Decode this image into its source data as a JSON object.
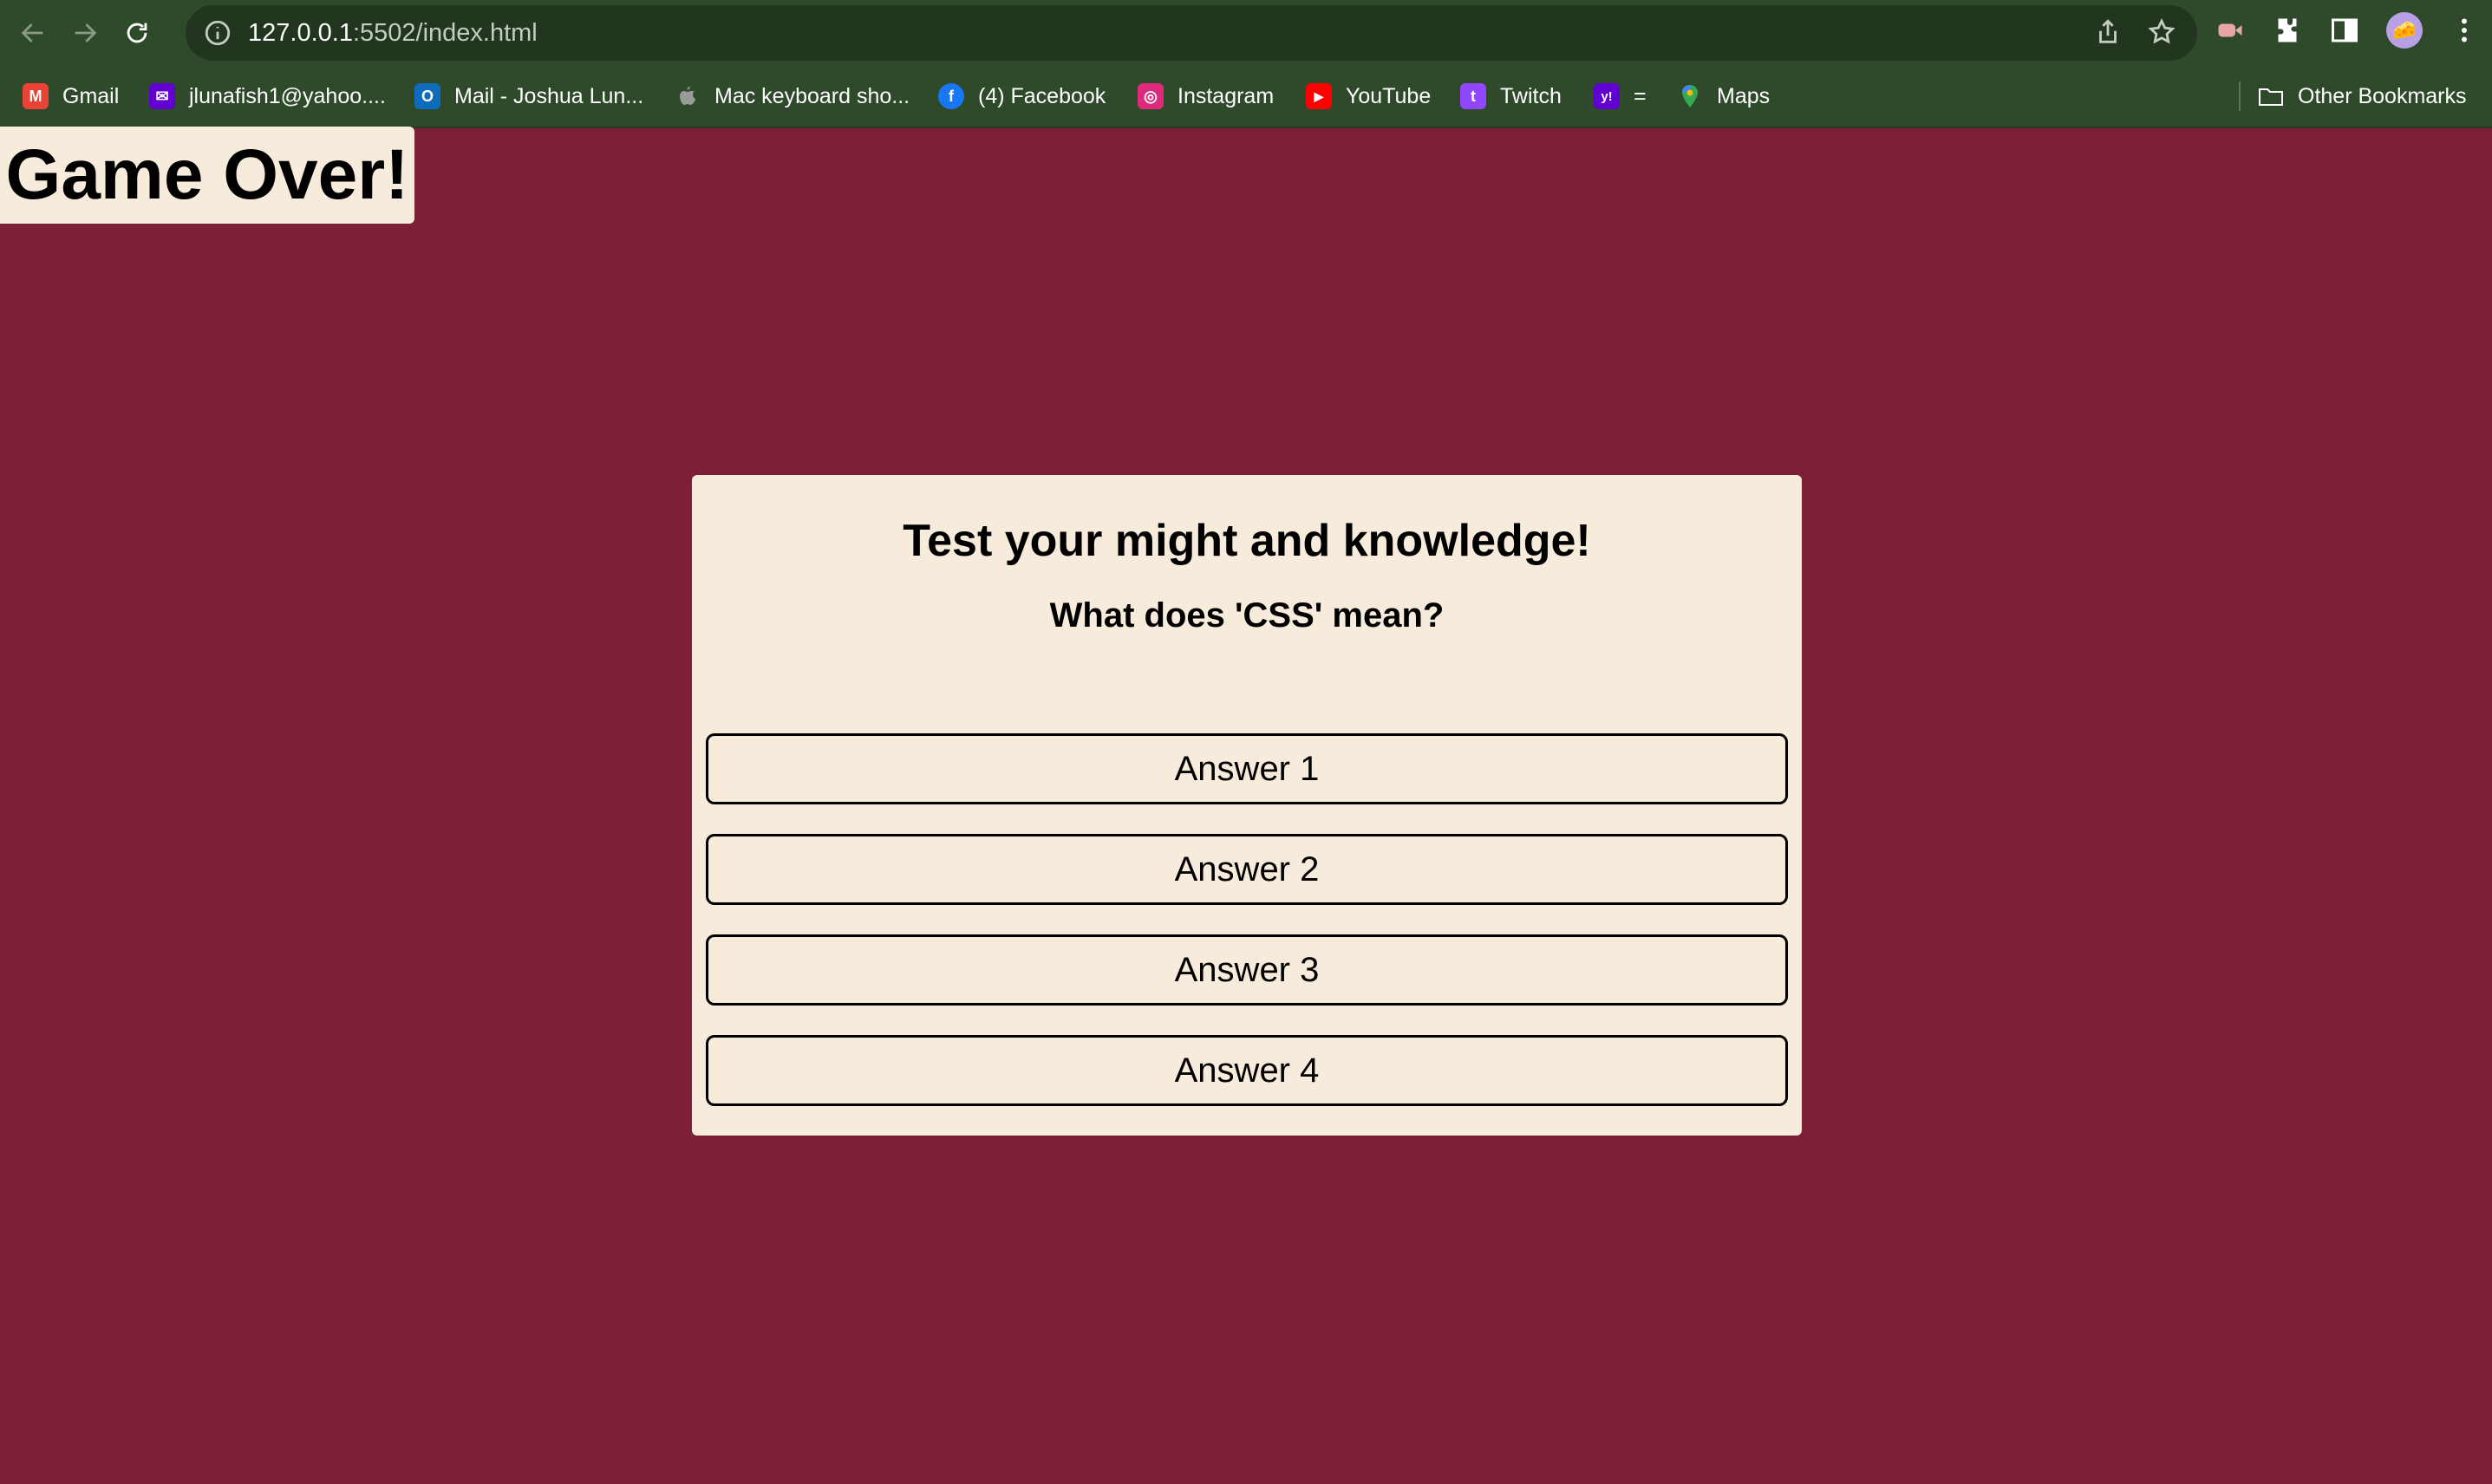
{
  "browser": {
    "url_host": "127.0.0.1",
    "url_path": ":5502/index.html",
    "avatar_emoji": "🧀"
  },
  "bookmarks": [
    {
      "label": "Gmail",
      "icon": "gmail-icon",
      "icon_text": "M",
      "color": "#ea4335"
    },
    {
      "label": "jlunafish1@yahoo....",
      "icon": "yahoo-mail-icon",
      "icon_text": "✉",
      "color": "#6001d2"
    },
    {
      "label": "Mail - Joshua Lun...",
      "icon": "outlook-icon",
      "icon_text": "O",
      "color": "#0f6cbd"
    },
    {
      "label": "Mac keyboard sho...",
      "icon": "apple-icon",
      "icon_text": "",
      "color": "#9a9a9a"
    },
    {
      "label": "(4) Facebook",
      "icon": "facebook-icon",
      "icon_text": "f",
      "color": "#1877f2"
    },
    {
      "label": "Instagram",
      "icon": "instagram-icon",
      "icon_text": "◎",
      "color": "#dd2a7b"
    },
    {
      "label": "YouTube",
      "icon": "youtube-icon",
      "icon_text": "▶",
      "color": "#ff0000"
    },
    {
      "label": "Twitch",
      "icon": "twitch-icon",
      "icon_text": "t",
      "color": "#9146ff"
    },
    {
      "label": "=",
      "icon": "yahoo-icon",
      "icon_text": "y!",
      "color": "#6001d2"
    },
    {
      "label": "Maps",
      "icon": "maps-icon",
      "icon_text": "●",
      "color": "#34a853"
    }
  ],
  "other_bookmarks": "Other Bookmarks",
  "game_over": "Game Over!",
  "quiz": {
    "title": "Test your might and knowledge!",
    "question": "What does 'CSS' mean?",
    "answers": [
      "Answer 1",
      "Answer 2",
      "Answer 3",
      "Answer 4"
    ]
  },
  "colors": {
    "page_bg": "#7e1f38",
    "card_bg": "#f7ecdc",
    "chrome_bg": "#2f4a2b"
  }
}
